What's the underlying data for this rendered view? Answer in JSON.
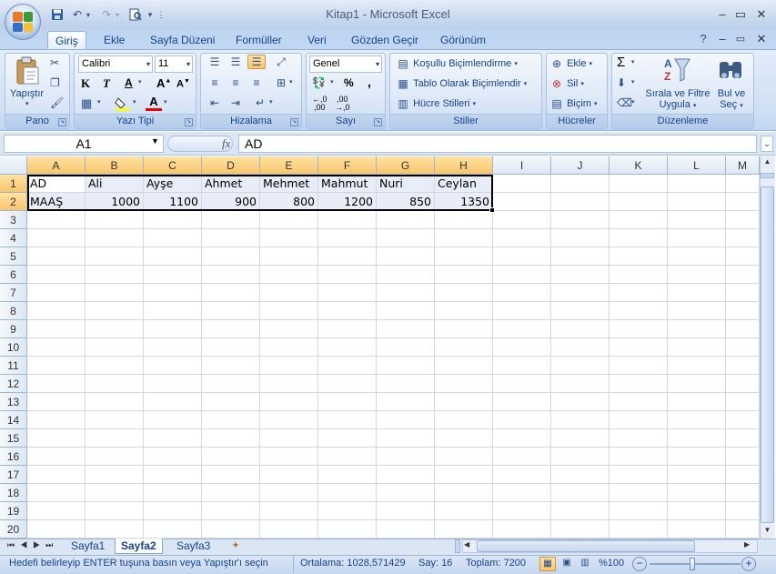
{
  "window": {
    "title": "Kitap1 - Microsoft Excel",
    "qat_icons": [
      "save-icon",
      "undo-icon",
      "redo-icon",
      "print-preview-icon",
      "customize-qat-icon"
    ],
    "controls": {
      "minimize": "–",
      "restore": "▭",
      "close": "✕"
    }
  },
  "tabs": [
    {
      "label": "Giriş",
      "active": true
    },
    {
      "label": "Ekle"
    },
    {
      "label": "Sayfa Düzeni"
    },
    {
      "label": "Formüller"
    },
    {
      "label": "Veri"
    },
    {
      "label": "Gözden Geçir"
    },
    {
      "label": "Görünüm"
    }
  ],
  "ribbon": {
    "pano": {
      "label": "Pano",
      "paste": "Yapıştır"
    },
    "font": {
      "label": "Yazı Tipi",
      "name": "Calibri",
      "size": "11",
      "bold": "K",
      "italic": "T",
      "underline": "A"
    },
    "align": {
      "label": "Hizalama"
    },
    "number": {
      "label": "Sayı",
      "format": "Genel",
      "percent": "%",
      "comma": ","
    },
    "styles": {
      "label": "Stiller",
      "conditional": "Koşullu Biçimlendirme",
      "table": "Tablo Olarak Biçimlendir",
      "cell_styles": "Hücre Stilleri"
    },
    "cells": {
      "label": "Hücreler",
      "insert": "Ekle",
      "delete": "Sil",
      "format": "Biçim"
    },
    "editing": {
      "label": "Düzenleme",
      "sort_filter_1": "Sırala ve Filtre",
      "sort_filter_2": "Uygula",
      "find_1": "Bul ve",
      "find_2": "Seç"
    }
  },
  "formula_bar": {
    "name_box": "A1",
    "fx": "fx",
    "value": "AD"
  },
  "sheet": {
    "columns": [
      "A",
      "B",
      "C",
      "D",
      "E",
      "F",
      "G",
      "H",
      "I",
      "J",
      "K",
      "L",
      "M"
    ],
    "rows": [
      "1",
      "2",
      "3",
      "4",
      "5",
      "6",
      "7",
      "8",
      "9",
      "10",
      "11",
      "12",
      "13",
      "14",
      "15",
      "16",
      "17",
      "18",
      "19",
      "20"
    ],
    "row1": [
      "AD",
      "Ali",
      "Ayşe",
      "Ahmet",
      "Mehmet",
      "Mahmut",
      "Nuri",
      "Ceylan"
    ],
    "row2": [
      "MAAŞ",
      "1000",
      "1100",
      "900",
      "800",
      "1200",
      "850",
      "1350"
    ]
  },
  "sheet_tabs": [
    {
      "label": "Sayfa1"
    },
    {
      "label": "Sayfa2",
      "active": true
    },
    {
      "label": "Sayfa3"
    }
  ],
  "status": {
    "message": "Hedefi belirleyip ENTER tuşuna basın veya Yapıştır'ı seçin",
    "average": "Ortalama: 1028,571429",
    "count": "Say: 16",
    "sum": "Toplam: 7200",
    "zoom": "%100"
  }
}
